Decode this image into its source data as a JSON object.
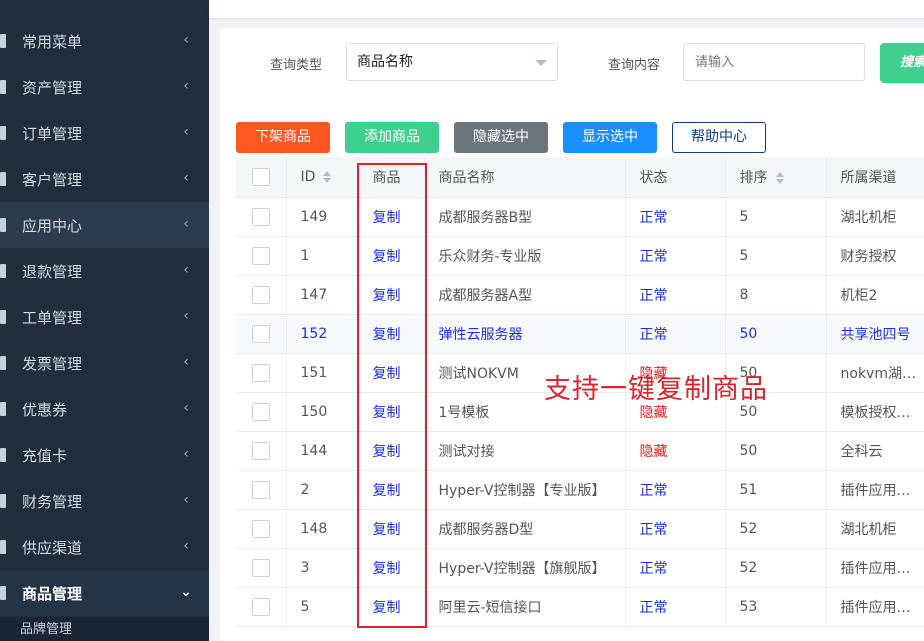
{
  "sidebar": {
    "items": [
      {
        "label": "常用菜单"
      },
      {
        "label": "资产管理"
      },
      {
        "label": "订单管理"
      },
      {
        "label": "客户管理"
      },
      {
        "label": "应用中心"
      },
      {
        "label": "退款管理"
      },
      {
        "label": "工单管理"
      },
      {
        "label": "发票管理"
      },
      {
        "label": "优惠券"
      },
      {
        "label": "充值卡"
      },
      {
        "label": "财务管理"
      },
      {
        "label": "供应渠道"
      },
      {
        "label": "商品管理"
      }
    ],
    "sub_item": "品牌管理",
    "chevron_collapsed": "‹",
    "chevron_expanded": "⌄"
  },
  "search": {
    "type_label": "查询类型",
    "type_value": "商品名称",
    "content_label": "查询内容",
    "content_placeholder": "请输入",
    "search_button": "搜索"
  },
  "actions": {
    "delist": "下架商品",
    "add": "添加商品",
    "hide_selected": "隐藏选中",
    "show_selected": "显示选中",
    "help": "帮助中心"
  },
  "table": {
    "headers": {
      "id": "ID",
      "product": "商品",
      "name": "商品名称",
      "status": "状态",
      "sort": "排序",
      "channel": "所属渠道"
    },
    "rows": [
      {
        "id": "149",
        "copy": "复制",
        "name": "成都服务器B型",
        "status": "正常",
        "sort": "5",
        "channel": "湖北机柜"
      },
      {
        "id": "1",
        "copy": "复制",
        "name": "乐众财务-专业版",
        "status": "正常",
        "sort": "5",
        "channel": "财务授权"
      },
      {
        "id": "147",
        "copy": "复制",
        "name": "成都服务器A型",
        "status": "正常",
        "sort": "8",
        "channel": "机柜2"
      },
      {
        "id": "152",
        "copy": "复制",
        "name": "弹性云服务器",
        "status": "正常",
        "sort": "50",
        "channel": "共享池四号"
      },
      {
        "id": "151",
        "copy": "复制",
        "name": "测试NOKVM",
        "status": "隐藏",
        "sort": "50",
        "channel": "nokvm湖北中"
      },
      {
        "id": "150",
        "copy": "复制",
        "name": "1号模板",
        "status": "隐藏",
        "sort": "50",
        "channel": "模板授权系统"
      },
      {
        "id": "144",
        "copy": "复制",
        "name": "测试对接",
        "status": "隐藏",
        "sort": "50",
        "channel": "全科云"
      },
      {
        "id": "2",
        "copy": "复制",
        "name": "Hyper-V控制器【专业版】",
        "status": "正常",
        "sort": "51",
        "channel": "插件应用授权"
      },
      {
        "id": "148",
        "copy": "复制",
        "name": "成都服务器D型",
        "status": "正常",
        "sort": "52",
        "channel": "湖北机柜"
      },
      {
        "id": "3",
        "copy": "复制",
        "name": "Hyper-V控制器【旗舰版】",
        "status": "正常",
        "sort": "52",
        "channel": "插件应用授权"
      },
      {
        "id": "5",
        "copy": "复制",
        "name": "阿里云-短信接口",
        "status": "正常",
        "sort": "53",
        "channel": "插件应用授权"
      }
    ]
  },
  "annotation": {
    "text": "支持一键复制商品",
    "color": "#d9232d"
  },
  "colors": {
    "sidebar_bg": "#1f2d3d",
    "red_button": "#fe5722",
    "green_button": "#3fcf8e",
    "gray_button": "#6c757d",
    "blue_button": "#1890ff",
    "link_blue": "#1b2ee0",
    "hidden_red": "#e02020"
  }
}
